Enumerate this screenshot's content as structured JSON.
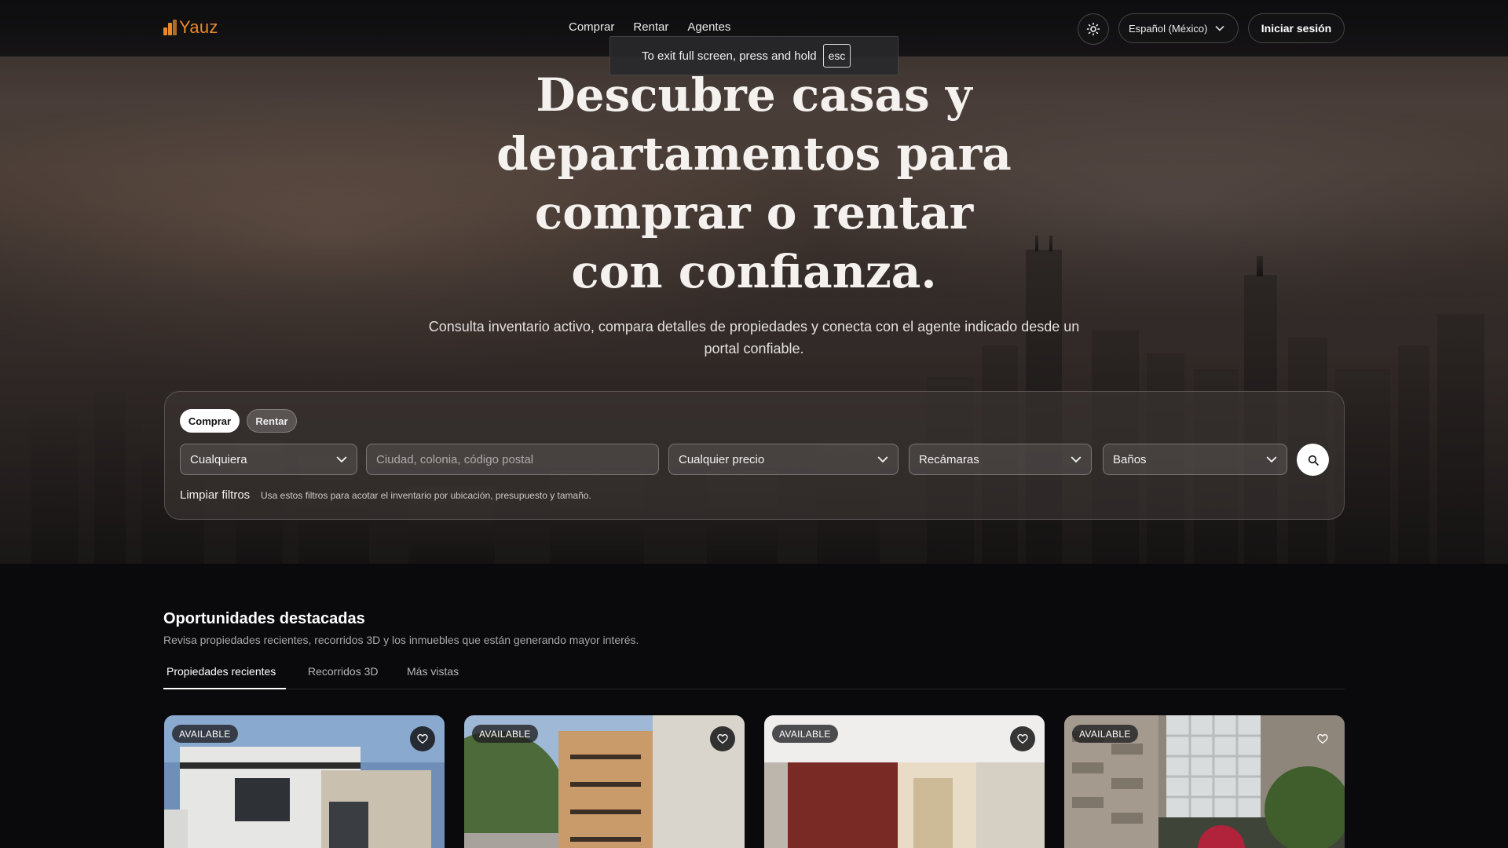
{
  "brand": {
    "name": "Yauz",
    "accent": "#e8892a"
  },
  "nav": {
    "items": [
      "Comprar",
      "Rentar",
      "Agentes"
    ]
  },
  "header": {
    "theme_icon": "sun-icon",
    "language": "Español (México)",
    "login": "Iniciar sesión"
  },
  "toast": {
    "text": "To exit full screen, press and hold",
    "key": "esc"
  },
  "hero": {
    "title_lines": [
      "Descubre casas y",
      "departamentos para",
      "comprar o rentar",
      "con confianza."
    ],
    "subtitle": "Consulta inventario activo, compara detalles de propiedades y conecta con el agente indicado desde un portal confiable."
  },
  "search": {
    "modes": [
      "Comprar",
      "Rentar"
    ],
    "active_mode": "Comprar",
    "type_value": "Cualquiera",
    "location_placeholder": "Ciudad, colonia, código postal",
    "price_value": "Cualquier precio",
    "bedrooms_value": "Recámaras",
    "bathrooms_value": "Baños",
    "clear_label": "Limpiar filtros",
    "hint": "Usa estos filtros para acotar el inventario por ubicación, presupuesto y tamaño."
  },
  "featured": {
    "title": "Oportunidades destacadas",
    "subtitle": "Revisa propiedades recientes, recorridos 3D y los inmuebles que están generando mayor interés.",
    "tabs": [
      "Propiedades recientes",
      "Recorridos 3D",
      "Más vistas"
    ],
    "active_tab": "Propiedades recientes",
    "cards": [
      {
        "badge": "AVAILABLE"
      },
      {
        "badge": "AVAILABLE"
      },
      {
        "badge": "AVAILABLE"
      },
      {
        "badge": "AVAILABLE"
      }
    ]
  }
}
